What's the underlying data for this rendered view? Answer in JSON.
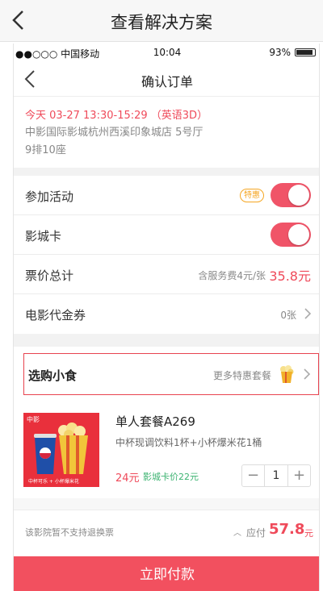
{
  "outer": {
    "title": "查看解决方案"
  },
  "status_bar": {
    "carrier": "●●○○○ 中国移动",
    "time": "10:04",
    "battery": "93%",
    "battery_level": 0.93
  },
  "nav": {
    "title": "确认订单"
  },
  "show": {
    "time": "今天 03-27 13:30-15:29 （英语3D）",
    "cinema": "中影国际影城杭州西溪印象城店 5号厅",
    "seat": "9排10座"
  },
  "rows": {
    "activity": {
      "label": "参加活动",
      "badge": "特惠",
      "enabled": true
    },
    "cinema_card": {
      "label": "影城卡",
      "enabled": true
    },
    "total": {
      "label": "票价总计",
      "note": "含服务费4元/张",
      "price": "35.8元"
    },
    "voucher": {
      "label": "电影代金券",
      "value": "0张"
    }
  },
  "snack": {
    "label": "选购小食",
    "more": "更多特惠套餐"
  },
  "combo": {
    "brand": "中影",
    "caption": "中杯可乐 + 小杯爆米花",
    "name": "单人套餐A269",
    "desc": "中杯现调饮料1杯+小杯爆米花1桶",
    "price": "24元",
    "card_price": "影城卡价22元",
    "minus": "−",
    "quantity": "1",
    "plus": "+"
  },
  "footer": {
    "refund_note": "该影院暂不支持退换票",
    "arrow": "︿",
    "due_label": "应付",
    "due_amount": "57.8",
    "due_unit": "元"
  },
  "pay": {
    "label": "立即付款"
  },
  "colors": {
    "accent": "#f2505f",
    "price_red": "#ef4a5a",
    "badge_orange": "#f5a623",
    "card_green": "#3cb371"
  }
}
